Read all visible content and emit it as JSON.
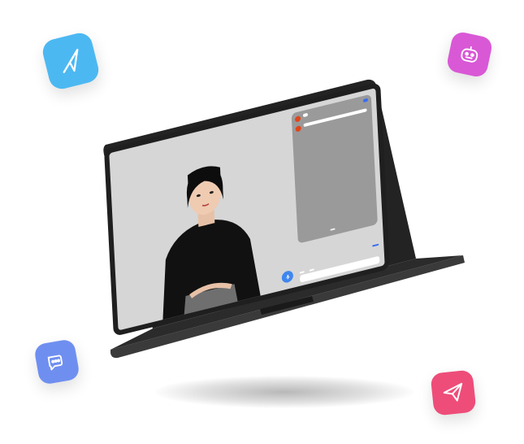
{
  "colors": {
    "tile_blue": "#4cb8f2",
    "tile_purple": "#d958d6",
    "tile_chat": "#6f8ff0",
    "tile_pink": "#ee4d79",
    "laptop_body": "#2a2a2a",
    "screen_bg": "#d6d6d6",
    "accent": "#3a6df0"
  },
  "icons": {
    "tile_top_left": "paper-plane-icon",
    "tile_top_right": "robot-icon",
    "tile_bottom_left": "chat-bubbles-icon",
    "tile_bottom_right": "send-icon",
    "mic": "microphone-icon"
  },
  "screen": {
    "chat": {
      "message_1": "",
      "reply_1": "",
      "message_2": "",
      "footer_button": ""
    },
    "input": {
      "chip_1": "",
      "chip_2": "",
      "send": "",
      "placeholder": ""
    }
  }
}
